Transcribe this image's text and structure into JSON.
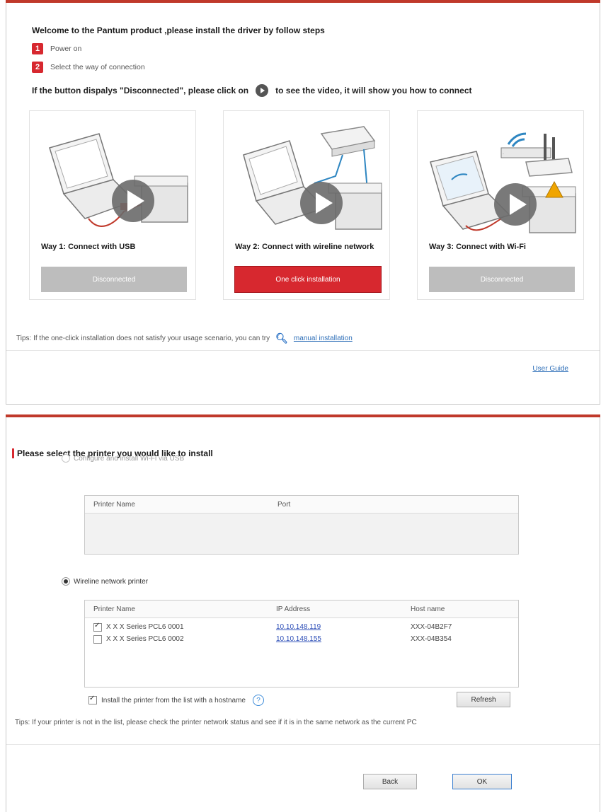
{
  "install_panel": {
    "welcome": "Welcome to the Pantum product ,please install the driver by follow steps",
    "steps": [
      {
        "num": "1",
        "label": "Power on"
      },
      {
        "num": "2",
        "label": "Select the way of connection"
      }
    ],
    "hint_before": "If the button dispalys \"Disconnected\", please click on",
    "hint_after": "to see the video, it will show you how to connect",
    "ways": [
      {
        "title": "Way 1: Connect with USB",
        "button": "Disconnected",
        "state": "disconnected"
      },
      {
        "title": "Way 2: Connect with wireline network",
        "button": "One click installation",
        "state": "active"
      },
      {
        "title": "Way 3: Connect with Wi-Fi",
        "button": "Disconnected",
        "state": "disconnected"
      }
    ],
    "tips_text": "Tips: If the one-click installation does not satisfy your usage scenario, you can try",
    "manual_link": "manual installation",
    "user_guide": "User Guide"
  },
  "select_panel": {
    "title": "Please select the printer you would like to install",
    "usb_option": "Configure and install Wi-Fi via USB",
    "usb_table": {
      "headers": [
        "Printer Name",
        "Port"
      ],
      "rows": []
    },
    "wireless_option": "Wireline network printer",
    "wireless_table": {
      "headers": [
        "Printer Name",
        "IP Address",
        "Host name"
      ],
      "rows": [
        {
          "name": "X X X Series PCL6 0001",
          "ip": "10.10.148.119",
          "host": "XXX-04B2F7",
          "checked": true
        },
        {
          "name": "X X X Series PCL6 0002",
          "ip": "10.10.148.155",
          "host": "XXX-04B354",
          "checked": false
        }
      ]
    },
    "hostname_checkbox": "Install the printer from the list with a hostname",
    "refresh_button": "Refresh",
    "tips": "Tips: If your printer is not in the list, please check the printer network status and see if it is in the same network as the current PC",
    "back_button": "Back",
    "ok_button": "OK"
  },
  "colors": {
    "accent_red": "#d7282f",
    "disconnected_gray": "#bdbdbd",
    "link_blue": "#2e6fb8"
  }
}
